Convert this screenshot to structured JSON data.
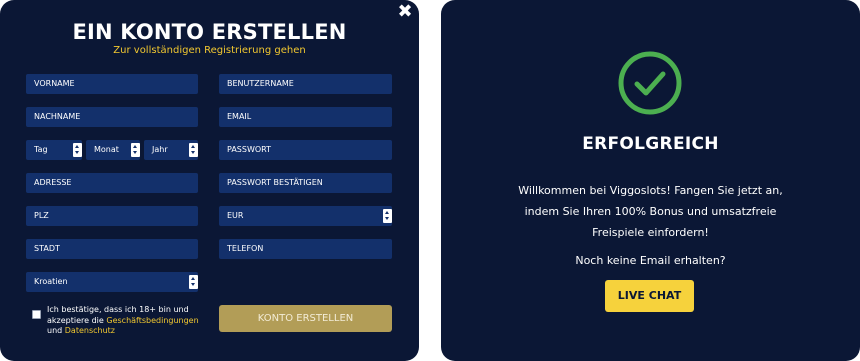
{
  "registration": {
    "title": "EIN KONTO ERSTELLEN",
    "subtitle": "Zur vollständigen Registrierung gehen",
    "fields": {
      "vorname": "VORNAME",
      "benutzername": "BENUTZERNAME",
      "nachname": "NACHNAME",
      "email": "EMAIL",
      "tag": "Tag",
      "monat": "Monat",
      "jahr": "Jahr",
      "passwort": "PASSWORT",
      "adresse": "ADRESSE",
      "passwort_bestaetigen": "PASSWORT BESTÄTIGEN",
      "plz": "PLZ",
      "waehrung": "EUR",
      "stadt": "STADT",
      "telefon": "TELEFON",
      "land": "Kroatien"
    },
    "consent": {
      "text_prefix": "Ich bestätige, dass ich 18+ bin und akzeptiere die",
      "terms_link": "Geschäftsbedingungen",
      "and_word": "und",
      "privacy_link": "Datenschutz"
    },
    "submit_label": "KONTO ERSTELLEN",
    "close_symbol": "✖"
  },
  "success": {
    "title": "ERFOLGREICH",
    "message": "Willkommen bei Viggoslots! Fangen Sie jetzt an, indem Sie Ihren 100% Bonus und umsatzfreie Freispiele einfordern!",
    "no_email": "Noch keine Email erhalten?",
    "live_chat_label": "LIVE CHAT"
  },
  "colors": {
    "modal_bg": "#0b1735",
    "field_bg": "#13306b",
    "accent_yellow": "#f2c830",
    "submit_bg": "#b29d57",
    "live_chat_bg": "#f6d23c",
    "success_green": "#4caf50"
  },
  "icons": {
    "close": "close-icon",
    "success": "check-circle-icon",
    "select": "select-arrows-icon"
  }
}
